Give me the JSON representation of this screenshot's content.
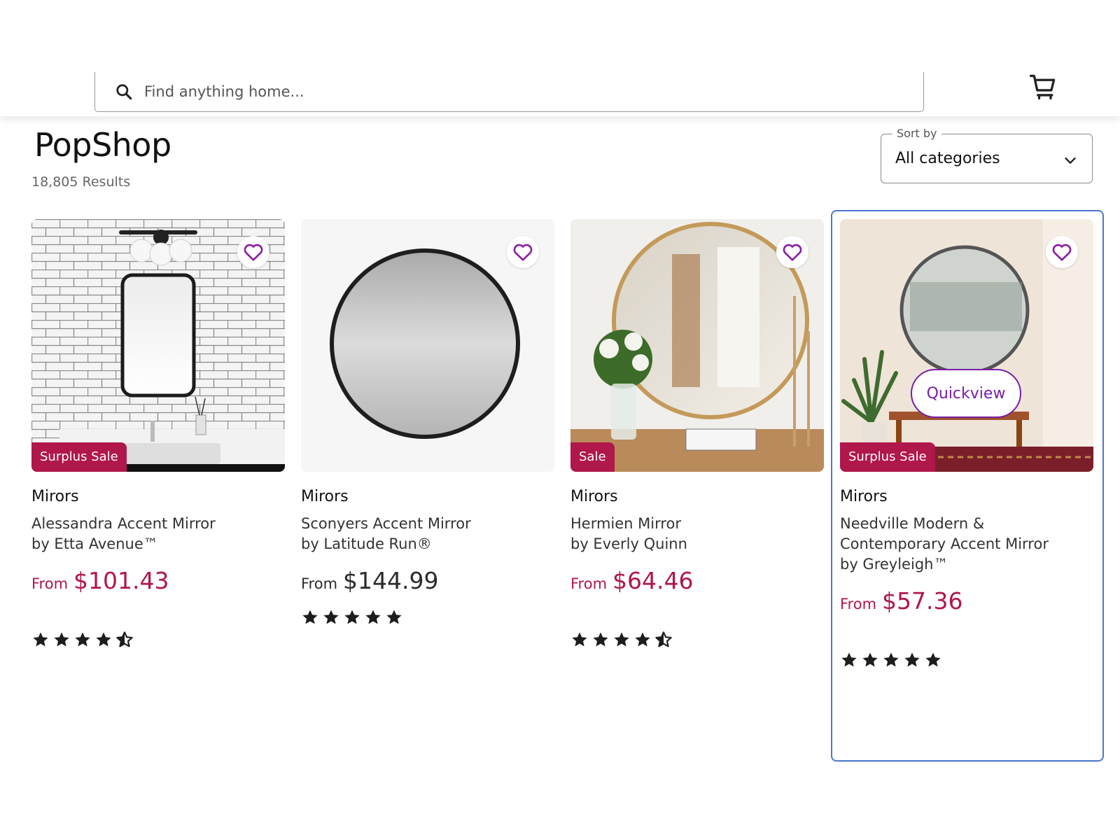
{
  "search": {
    "placeholder": "Find anything home..."
  },
  "header": {
    "brand": "PopShop",
    "results": "18,805 Results"
  },
  "sort": {
    "legend": "Sort by",
    "value": "All categories"
  },
  "colors": {
    "accent": "#b0174a",
    "heart": "#8b1fa6",
    "selection": "#4a76d4"
  },
  "products": [
    {
      "category": "Mirors",
      "name_line1": "Alessandra Accent Mirror",
      "name_line2": "by Etta Avenue™",
      "name_line3": "",
      "from": "From",
      "price": "$101.43",
      "badge": "Surplus Sale",
      "rating": 4.5
    },
    {
      "category": "Mirors",
      "name_line1": "Sconyers Accent Mirror",
      "name_line2": "by Latitude Run®",
      "name_line3": "",
      "from": "From",
      "price": "$144.99",
      "badge": "",
      "rating": 5
    },
    {
      "category": "Mirors",
      "name_line1": "Hermien Mirror",
      "name_line2": "by Everly Quinn",
      "name_line3": "",
      "from": "From",
      "price": "$64.46",
      "badge": "Sale",
      "rating": 4.5
    },
    {
      "category": "Mirors",
      "name_line1": "Needville Modern &",
      "name_line2": "Contemporary Accent Mirror",
      "name_line3": "by Greyleigh™",
      "from": "From",
      "price": "$57.36",
      "badge": "Surplus Sale",
      "quickview": "Quickview",
      "rating": 5
    }
  ]
}
